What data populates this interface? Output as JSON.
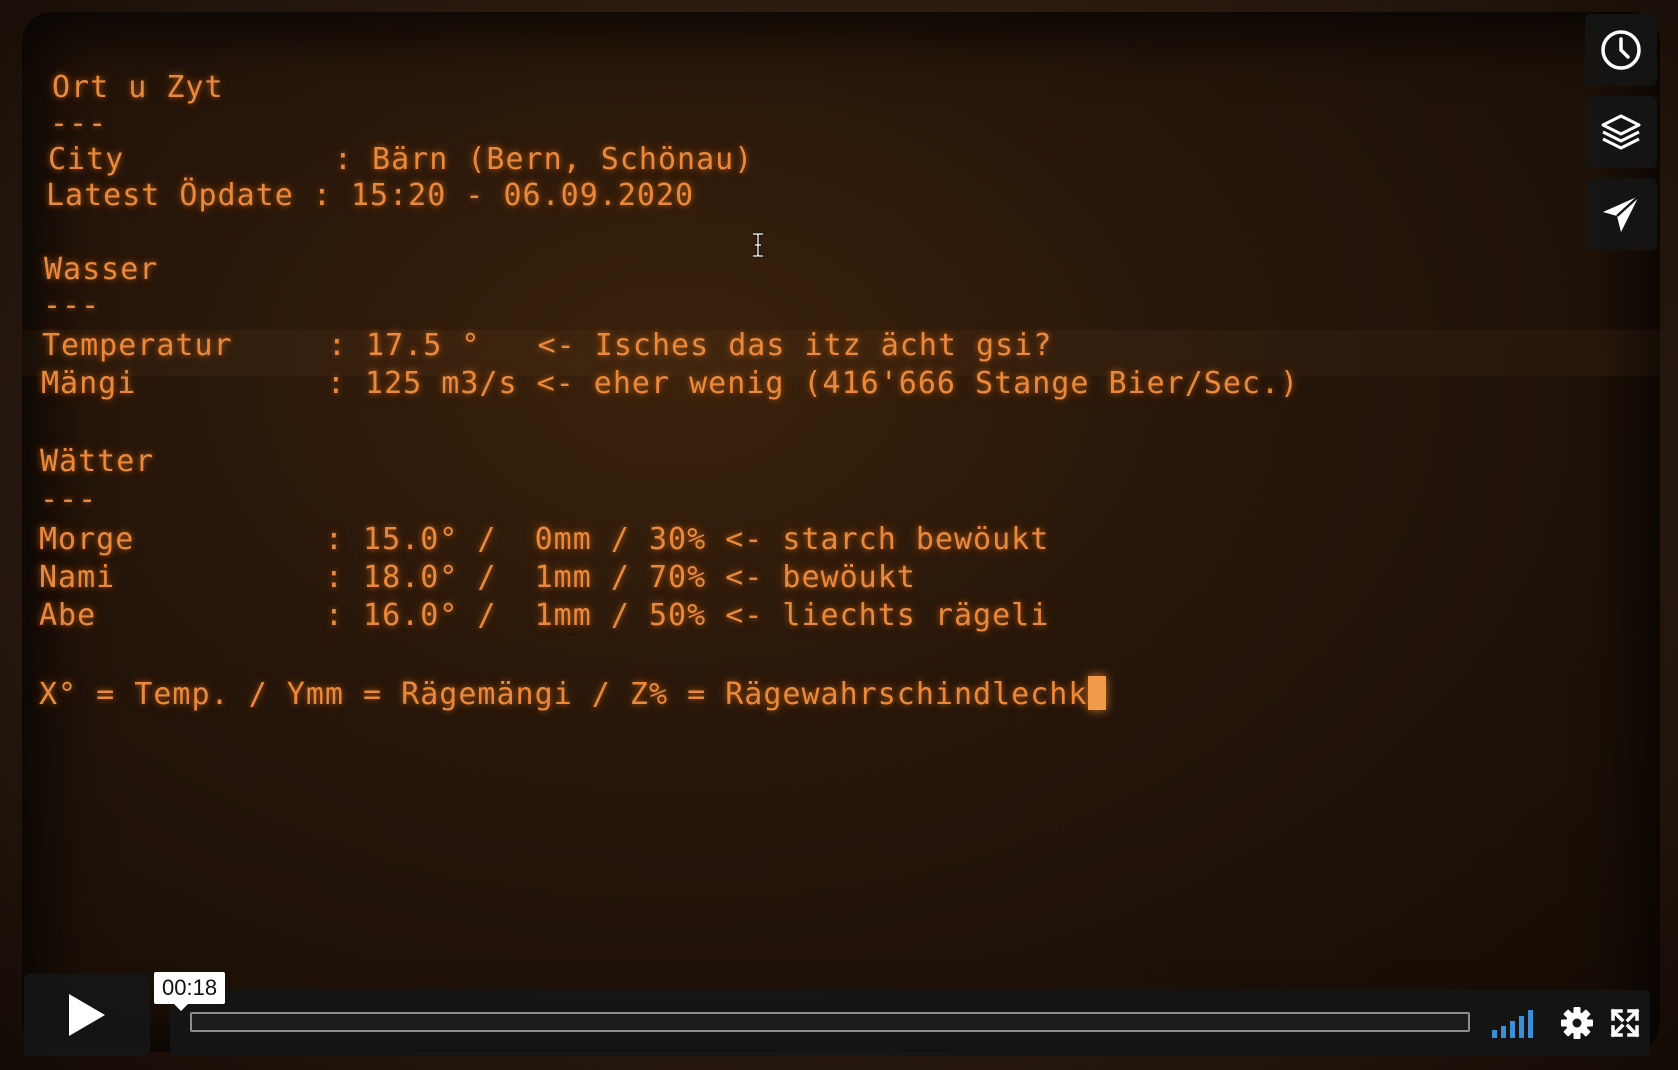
{
  "terminal": {
    "lines": [
      "Ort u Zyt",
      "---",
      "City           : Bärn (Bern, Schönau)",
      "Latest Öpdate : 15:20 - 06.09.2020",
      "Wasser",
      "---",
      "Temperatur     : 17.5 °   <- Isches das itz ächt gsi?",
      "Mängi          : 125 m3/s <- eher wenig (416'666 Stange Bier/Sec.)",
      "Wätter",
      "---",
      "Morge          : 15.0° /  0mm / 30% <- starch bewöukt",
      "Nami           : 18.0° /  1mm / 70% <- bewöukt",
      "Abe            : 16.0° /  1mm / 50% <- liechts rägeli",
      "X° = Temp. / Ymm = Rägemängi / Z% = Rägewahrschindlechk"
    ]
  },
  "player": {
    "current_time": "00:18",
    "progress": 0.0,
    "accent_color": "#e8893c",
    "side_buttons": [
      "clock-icon",
      "layers-icon",
      "send-icon"
    ],
    "controls": [
      "play-icon",
      "volume-icon",
      "settings-icon",
      "fullscreen-icon"
    ]
  }
}
